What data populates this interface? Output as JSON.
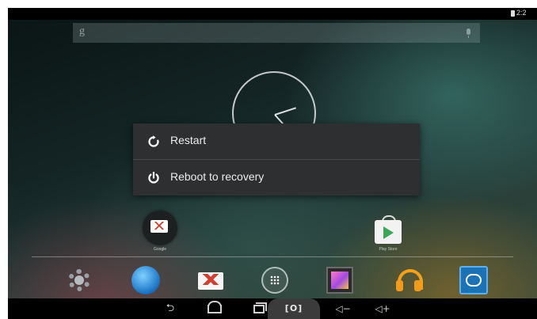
{
  "status_bar": {
    "time": "2:2"
  },
  "search": {
    "logo": "g",
    "mic_icon": "mic-icon"
  },
  "power_menu": {
    "items": [
      {
        "label": "Restart",
        "icon": "restart-icon"
      },
      {
        "label": "Reboot to recovery",
        "icon": "power-icon"
      }
    ]
  },
  "home": {
    "google_folder_label": "Google",
    "play_store_label": "Play Store"
  },
  "dock": {
    "apps": [
      "settings-icon",
      "browser-icon",
      "gmail-icon",
      "all-apps-icon",
      "gallery-icon",
      "music-icon",
      "video-icon"
    ]
  },
  "nav_bar": {
    "back": "⮌",
    "screenshot": "[O]",
    "volume_down": "◁−",
    "volume_up": "◁+"
  },
  "colors": {
    "dialog_bg": "#2e2f30",
    "status_bar_bg": "#000000",
    "text": "#ececec"
  }
}
